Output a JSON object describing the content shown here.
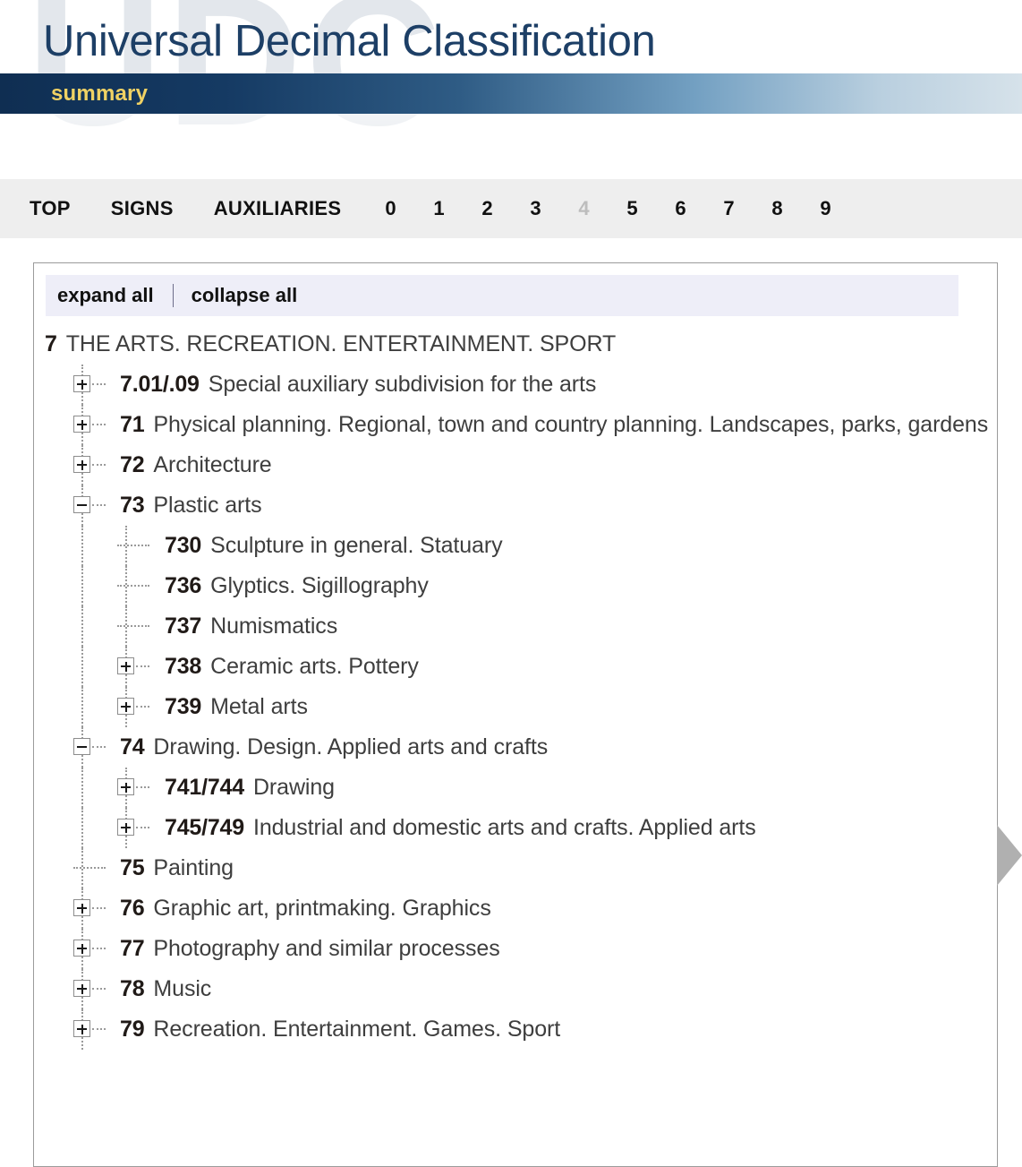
{
  "masthead": {
    "title": "Universal Decimal Classification",
    "subtitle": "summary",
    "watermark": "UDC",
    "title_color": "#1d3f66",
    "subtitle_color": "#f0d264",
    "bar_gradient_from": "#0f2e52",
    "bar_gradient_to": "#d6e2ea"
  },
  "nav": {
    "words": [
      {
        "label": "TOP",
        "disabled": false
      },
      {
        "label": "SIGNS",
        "disabled": false
      },
      {
        "label": "AUXILIARIES",
        "disabled": false
      }
    ],
    "digits": [
      {
        "label": "0",
        "disabled": false
      },
      {
        "label": "1",
        "disabled": false
      },
      {
        "label": "2",
        "disabled": false
      },
      {
        "label": "3",
        "disabled": false
      },
      {
        "label": "4",
        "disabled": true
      },
      {
        "label": "5",
        "disabled": false
      },
      {
        "label": "6",
        "disabled": false
      },
      {
        "label": "7",
        "disabled": false
      },
      {
        "label": "8",
        "disabled": false
      },
      {
        "label": "9",
        "disabled": false
      }
    ],
    "background": "#eeeeee",
    "disabled_color": "#bdbdbd"
  },
  "toolbar": {
    "expand_all": "expand all",
    "collapse_all": "collapse all",
    "background": "#eeeef8"
  },
  "tree": {
    "rows": [
      {
        "code": "7",
        "label": "THE ARTS. RECREATION. ENTERTAINMENT. SPORT",
        "level": 0,
        "toggle": "none"
      },
      {
        "code": "7.01/.09",
        "label": "Special auxiliary subdivision for the arts",
        "level": 1,
        "toggle": "plus"
      },
      {
        "code": "71",
        "label": "Physical planning. Regional, town and country planning. Landscapes, parks, gardens",
        "level": 1,
        "toggle": "plus"
      },
      {
        "code": "72",
        "label": "Architecture",
        "level": 1,
        "toggle": "plus"
      },
      {
        "code": "73",
        "label": "Plastic arts",
        "level": 1,
        "toggle": "minus"
      },
      {
        "code": "730",
        "label": "Sculpture in general. Statuary",
        "level": 2,
        "toggle": "none"
      },
      {
        "code": "736",
        "label": "Glyptics. Sigillography",
        "level": 2,
        "toggle": "none"
      },
      {
        "code": "737",
        "label": "Numismatics",
        "level": 2,
        "toggle": "none"
      },
      {
        "code": "738",
        "label": "Ceramic arts. Pottery",
        "level": 2,
        "toggle": "plus"
      },
      {
        "code": "739",
        "label": "Metal arts",
        "level": 2,
        "toggle": "plus"
      },
      {
        "code": "74",
        "label": "Drawing. Design. Applied arts and crafts",
        "level": 1,
        "toggle": "minus"
      },
      {
        "code": "741/744",
        "label": "Drawing",
        "level": 2,
        "toggle": "plus"
      },
      {
        "code": "745/749",
        "label": "Industrial and domestic arts and crafts. Applied arts",
        "level": 2,
        "toggle": "plus"
      },
      {
        "code": "75",
        "label": "Painting",
        "level": 1,
        "toggle": "none"
      },
      {
        "code": "76",
        "label": "Graphic art, printmaking. Graphics",
        "level": 1,
        "toggle": "plus"
      },
      {
        "code": "77",
        "label": "Photography and similar processes",
        "level": 1,
        "toggle": "plus"
      },
      {
        "code": "78",
        "label": "Music",
        "level": 1,
        "toggle": "plus"
      },
      {
        "code": "79",
        "label": "Recreation. Entertainment. Games. Sport",
        "level": 1,
        "toggle": "plus"
      }
    ]
  },
  "pager": {
    "next_icon": "triangle-right-icon",
    "color": "#b0b0b0"
  }
}
